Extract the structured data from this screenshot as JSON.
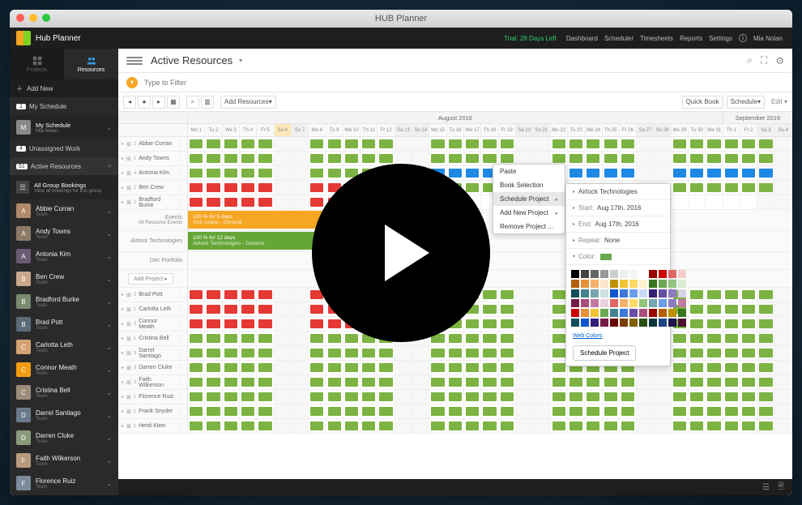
{
  "window_title": "HUB Planner",
  "app_name": "Hub Planner",
  "trial_text": "Trial: 28 Days Left",
  "nav": [
    "Dashboard",
    "Scheduler",
    "Timesheets",
    "Reports",
    "Settings"
  ],
  "user_name": "Mia Nolan",
  "sidebar": {
    "tabs": {
      "projects": "Projects",
      "resources": "Resources"
    },
    "add_new": "Add New",
    "my_schedule": {
      "badge": "1",
      "label": "My Schedule"
    },
    "my_schedule_user": {
      "name": "My Schedule",
      "sub": "Mia Nolan"
    },
    "unassigned": {
      "badge": "4",
      "label": "Unassigned Work"
    },
    "active": {
      "badge": "51",
      "label": "Active Resources"
    },
    "group": {
      "title": "All Group Bookings",
      "sub": "View all bookings for this group"
    },
    "people": [
      {
        "name": "Abbie Curran",
        "sub": "Team",
        "color": "#b08968"
      },
      {
        "name": "Andy Towns",
        "sub": "Team",
        "color": "#8d7b68"
      },
      {
        "name": "Antonia Kim",
        "sub": "Team",
        "color": "#6b5b73"
      },
      {
        "name": "Ben Crew",
        "sub": "Team",
        "color": "#c9a88a"
      },
      {
        "name": "Bradford Burke",
        "sub": "Team",
        "color": "#7a8b6f"
      },
      {
        "name": "Brad Pott",
        "sub": "Team",
        "color": "#5a6b7a"
      },
      {
        "name": "Carlotta Leth",
        "sub": "Team",
        "color": "#d4a373"
      },
      {
        "name": "Connor Meath",
        "sub": "Team",
        "color": "#f39c12"
      },
      {
        "name": "Cristina Bell",
        "sub": "Team",
        "color": "#9c8b7a"
      },
      {
        "name": "Darrel Santiago",
        "sub": "Team",
        "color": "#6a7a8b"
      },
      {
        "name": "Darren Cluke",
        "sub": "Team",
        "color": "#8a9b7c"
      },
      {
        "name": "Faith Wilkerson",
        "sub": "Team",
        "color": "#b89a7c"
      },
      {
        "name": "Florence Ruiz",
        "sub": "Team",
        "color": "#7c8a9b"
      }
    ]
  },
  "page_title": "Active Resources",
  "filter_placeholder": "Type to Filter",
  "toolbar": {
    "add_resources": "Add Resources",
    "quick_book": "Quick Book",
    "schedule": "Schedule",
    "edit": "Edit"
  },
  "calendar": {
    "month1": "August 2016",
    "month2": "September 2016",
    "days": [
      "Mo 1",
      "Tu 2",
      "We 3",
      "Th 4",
      "Fr 5",
      "Sa 6",
      "Su 7",
      "Mo 8",
      "Tu 9",
      "We 10",
      "Th 11",
      "Fr 12",
      "Sa 13",
      "Su 14",
      "Mo 15",
      "Tu 16",
      "We 17",
      "Th 18",
      "Fr 19",
      "Sa 20",
      "Su 21",
      "Mo 22",
      "Tu 23",
      "We 24",
      "Th 25",
      "Fr 26",
      "Sa 27",
      "Su 28",
      "Mo 29",
      "Tu 30",
      "We 31",
      "Th 1",
      "Fr 2",
      "Sa 3",
      "Su 4"
    ],
    "resources": [
      {
        "n": "Abbie Curran",
        "c": "2",
        "p": "gggggxxgggggxxgggggxxgggggxxggggggxx"
      },
      {
        "n": "Andy Towns",
        "c": "1",
        "p": "gggggxxgggggxxgggggxxgggggxxggggggxx"
      },
      {
        "n": "Antonia Kim",
        "c": "4",
        "p": "gggggxxgggggxxbbbbbxxbbbbbxxbbbbbbxx"
      },
      {
        "n": "Ben Crew",
        "c": "2",
        "p": "rrrrrxxrrrrrxxgggggxxgggggxxggggggxx"
      },
      {
        "n": "Bradford Burke",
        "c": "2",
        "p": "rrrrrxxrrrrrxx..................."
      }
    ],
    "expanded": {
      "events": {
        "label": "Events",
        "sub": "All Resource Events",
        "bar_title": "100 % for 5 days",
        "bar_sub": "Sick Leave - General"
      },
      "airlock": {
        "label": "Airlock Technologies",
        "bar_title": "100 % for 12 days",
        "bar_sub": "Airlock Technologies - General"
      },
      "dec": {
        "label": "Dec Portfolio"
      },
      "add": "Add Project"
    },
    "resources2": [
      {
        "n": "Brad Pott",
        "c": "2",
        "p": "rrrrrxxrrrrrxxgggggxxgggggxxggggggxx"
      },
      {
        "n": "Carlotta Leth",
        "c": "1",
        "p": "rrrrrxxrrrrrxxgggggxxgggggxxggggggxx"
      },
      {
        "n": "Connor Meath",
        "c": "3",
        "p": "rrrrrxxrrrrrxxgggggxxgggggxxggggggxx"
      },
      {
        "n": "Cristina Bell",
        "c": "1",
        "p": "gggggxxgggggxxgggggxxgggggxxggggggxx"
      },
      {
        "n": "Darrel Santiago",
        "c": "3",
        "p": "gggggxxgggggxxgggggxxgggggxxggggggxx"
      },
      {
        "n": "Darren Cluke",
        "c": "3",
        "p": "gggggxxgggggxxgggggxxgggggxxggggggxx"
      },
      {
        "n": "Faith Wilkerson",
        "c": "2",
        "p": "gggggxxgggggxxgggggxxgggggxxggggggxx"
      },
      {
        "n": "Florence Ruiz",
        "c": "1",
        "p": "gggggxxgggggxxgggggxxgggggxxggggggxx"
      },
      {
        "n": "Frank Snyder",
        "c": "1",
        "p": "gggggxxgggggxxgggggxxgggggxxggggggxx"
      },
      {
        "n": "Heidi Klein",
        "c": "1",
        "p": "gggggxxgggggxxgggggxxgggggxxggggggxx"
      }
    ]
  },
  "context_menu": {
    "items": [
      "Paste",
      "Book Selection",
      "Schedule Project",
      "Add New Project",
      "Remove Project ..."
    ],
    "highlighted": 2
  },
  "submenu": {
    "project": "Airlock Technologies",
    "start": {
      "lbl": "Start:",
      "val": "Aug 17th, 2016"
    },
    "end": {
      "lbl": "End:",
      "val": "Aug 17th, 2016"
    },
    "repeat": {
      "lbl": "Repeat:",
      "val": "None"
    },
    "color_lbl": "Color:",
    "web_colors": "Web Colors",
    "schedule_btn": "Schedule Project",
    "swatches": [
      "#000",
      "#444",
      "#666",
      "#999",
      "#ccc",
      "#eee",
      "#f4f4f4",
      "#fff",
      "#900",
      "#c00",
      "#e06666",
      "#f4cccc",
      "#b45f06",
      "#e69138",
      "#f6b26b",
      "#fce5cd",
      "#bf9000",
      "#f1c232",
      "#ffd966",
      "#fff2cc",
      "#38761d",
      "#6aa84f",
      "#93c47d",
      "#d9ead3",
      "#134f5c",
      "#45818e",
      "#76a5af",
      "#d0e0e3",
      "#1155cc",
      "#3c78d8",
      "#6d9eeb",
      "#c9daf8",
      "#351c75",
      "#674ea7",
      "#8e7cc3",
      "#d9d2e9",
      "#741b47",
      "#a64d79",
      "#c27ba0",
      "#ead1dc",
      "#e06666",
      "#f6b26b",
      "#ffd966",
      "#93c47d",
      "#76a5af",
      "#6d9eeb",
      "#8e7cc3",
      "#c27ba0",
      "#cc0000",
      "#e69138",
      "#f1c232",
      "#6aa84f",
      "#45818e",
      "#3c78d8",
      "#674ea7",
      "#a64d79",
      "#990000",
      "#b45f06",
      "#bf9000",
      "#38761d",
      "#134f5c",
      "#1155cc",
      "#351c75",
      "#741b47",
      "#660000",
      "#783f04",
      "#7f6000",
      "#274e13",
      "#0c343d",
      "#1c4587",
      "#20124d",
      "#4c1130"
    ]
  }
}
